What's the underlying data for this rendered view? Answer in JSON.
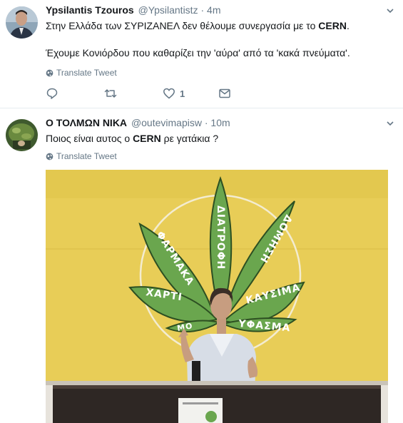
{
  "tweets": [
    {
      "display_name": "Ypsilantis Tzouros",
      "handle": "@Ypsilantistz",
      "separator": "·",
      "time": "4m",
      "text_line1_prefix": "Στην Ελλάδα των ΣΥΡΙΖΑΝΕΛ δεν θέλουμε συνεργασία με το ",
      "text_line1_bold": "CERN",
      "text_line1_suffix": ".",
      "text_line2": "Έχουμε Κονιόρδου που καθαρίζει την 'αύρα' από τα 'κακά πνεύματα'.",
      "translate_label": "Translate Tweet",
      "like_count": "1"
    },
    {
      "display_name": "Ο ΤΟΛΜΩΝ ΝΙΚΑ",
      "handle": "@outevimapisw",
      "separator": "·",
      "time": "10m",
      "text_prefix": "Ποιος είναι αυτος ο ",
      "text_bold": "CERN",
      "text_suffix": " ρε γατάκια ?",
      "translate_label": "Translate Tweet",
      "media_words": {
        "leaf_left_lower": "ΧΑΡΤΙ",
        "leaf_left_upper": "ΦΑΡΜΑΚΑ",
        "leaf_center": "ΔΙΑΤΡΟΦΗ",
        "leaf_right_upper": "ΔΟΜΗΣΗ",
        "leaf_right_lower": "ΚΑΥΣΙΜΑ",
        "leaf_bottom_right": "ΥΦΑΣΜΑ",
        "leaf_bottom_left": "ΜΟ"
      }
    }
  ]
}
